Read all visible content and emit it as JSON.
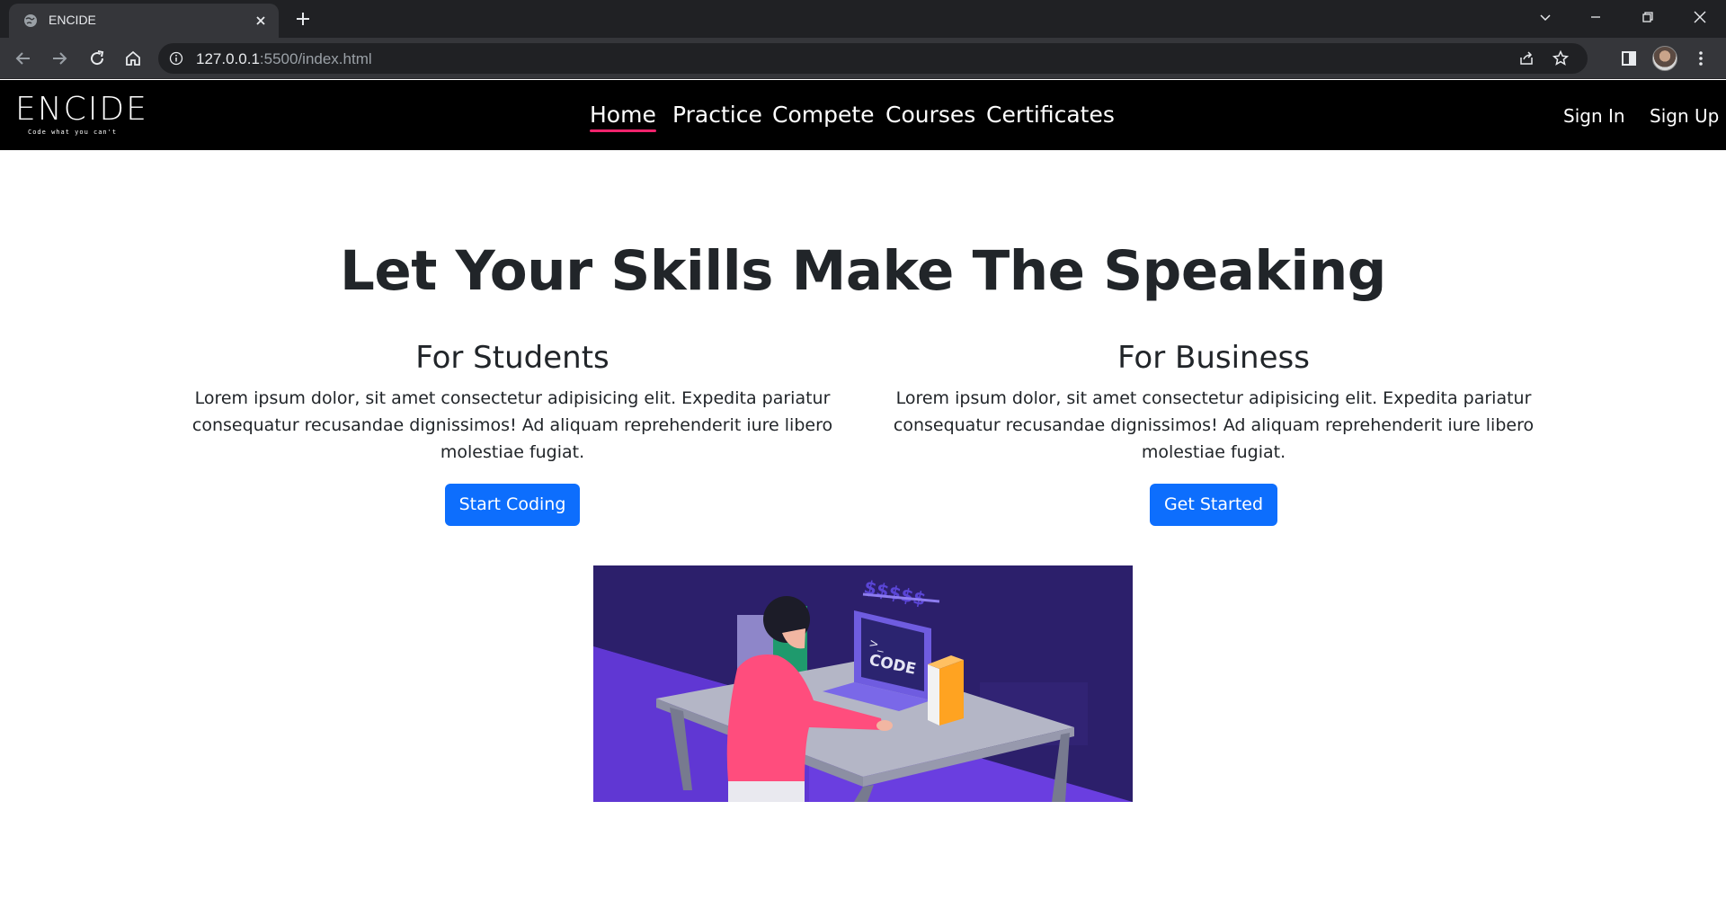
{
  "browser": {
    "tab_title": "ENCIDE",
    "url_host": "127.0.0.1",
    "url_rest": ":5500/index.html"
  },
  "site": {
    "logo_text": "ENCIDE",
    "logo_tagline": "Code what you can't",
    "nav": [
      {
        "label": "Home",
        "active": true
      },
      {
        "label": "Practice",
        "active": false
      },
      {
        "label": "Compete",
        "active": false
      },
      {
        "label": "Courses",
        "active": false
      },
      {
        "label": "Certificates",
        "active": false
      }
    ],
    "sign_in": "Sign In",
    "sign_up": "Sign Up",
    "accent_color": "#f0236c"
  },
  "hero": {
    "title": "Let Your Skills Make The Speaking"
  },
  "columns": [
    {
      "heading": "For Students",
      "text": "Lorem ipsum dolor, sit amet consectetur adipisicing elit. Expedita pariatur consequatur recusandae dignissimos! Ad aliquam reprehenderit iure libero molestiae fugiat.",
      "button": "Start Coding"
    },
    {
      "heading": "For Business",
      "text": "Lorem ipsum dolor, sit amet consectetur adipisicing elit. Expedita pariatur consequatur recusandae dignissimos! Ad aliquam reprehenderit iure libero molestiae fugiat.",
      "button": "Get Started"
    }
  ],
  "illustration": {
    "laptop_text_prompt": ">_",
    "laptop_text": "CODE",
    "price_text": "$$$$$"
  },
  "colors": {
    "button_blue": "#0d6efd",
    "illustration_bg": "#2c1f6b",
    "illustration_floor": "#6a3ee0"
  }
}
